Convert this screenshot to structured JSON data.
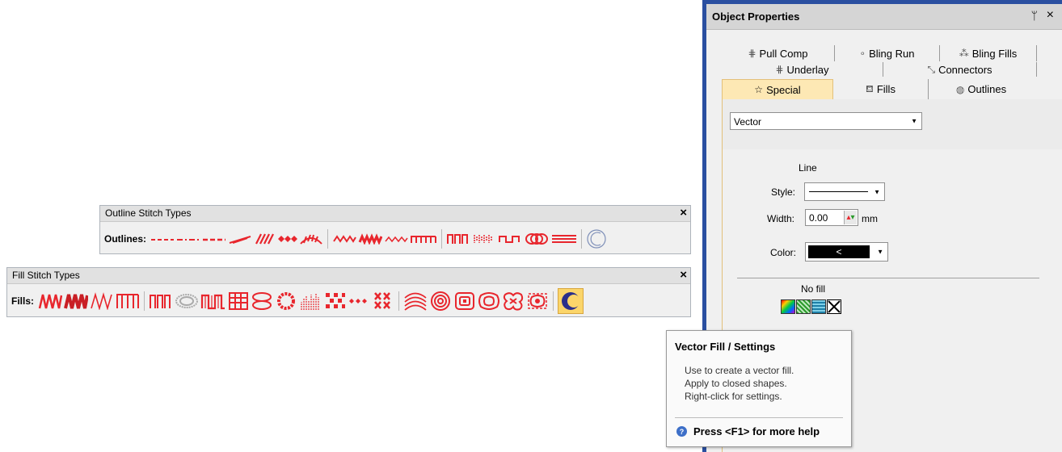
{
  "outline_toolbar": {
    "title": "Outline Stitch Types",
    "close": "×",
    "row_label": "Outlines:",
    "icons": [
      "dash-outline-icon",
      "dash-dot-outline-icon",
      "triple-dash-outline-icon",
      "zigzag-outline-icon",
      "satin-outline-icon",
      "motif-outline-icon",
      "feather-outline-icon",
      "blackwork-outline-icon",
      "e-stitch-outline-icon",
      "frill-outline-icon",
      "square-outline-icon",
      "tatami-outline-icon",
      "fancy-outline-icon",
      "backstitch-outline-icon",
      "ring-outline-icon",
      "striped-outline-icon",
      "crescent-outline-icon"
    ]
  },
  "fill_toolbar": {
    "title": "Fill Stitch Types",
    "close": "×",
    "row_label": "Fills:",
    "icons": [
      "zigzag-fill-icon",
      "satin-fill-icon",
      "diagonal-fill-icon",
      "square-fill-icon",
      "tatami-fill-icon",
      "ring-fill-icon",
      "step-fill-icon",
      "cross-fill-icon",
      "link-fill-icon",
      "flower-fill-icon",
      "gradient-fill-icon",
      "diamond-fill-icon",
      "sparkle-fill-icon",
      "x-fill-icon",
      "wave-fill-icon",
      "spiral-fill-icon",
      "square-spiral-fill-icon",
      "fancy-fill-icon",
      "motif-fill-icon",
      "lace-fill-icon",
      "vector-fill-icon"
    ],
    "selected_icon": "vector-fill-icon"
  },
  "object_properties": {
    "title": "Object Properties",
    "pin": "ᛘ",
    "close": "×",
    "tabs_row1": [
      {
        "label": "Pull Comp",
        "icon": "pull-comp-icon"
      },
      {
        "label": "Bling Run",
        "icon": "bling-run-icon"
      },
      {
        "label": "Bling Fills",
        "icon": "bling-fills-icon"
      }
    ],
    "tabs_row2": [
      {
        "label": "Underlay",
        "icon": "underlay-icon"
      },
      {
        "label": "Connectors",
        "icon": "connectors-icon"
      }
    ],
    "tabs_row3": [
      {
        "label": "Special",
        "icon": "star-icon",
        "active": true
      },
      {
        "label": "Fills",
        "icon": "paint-bucket-icon"
      },
      {
        "label": "Outlines",
        "icon": "outline-icon"
      }
    ],
    "mode_dropdown": "Vector",
    "line_heading": "Line",
    "style_label": "Style:",
    "width_label": "Width:",
    "width_value": "0.00",
    "width_unit": "mm",
    "color_label": "Color:",
    "color_arrow": "<",
    "color_value": "#000000",
    "fill_heading": "No fill"
  },
  "tooltip": {
    "title": "Vector Fill / Settings",
    "lines": [
      "Use to create a vector fill.",
      "Apply to closed shapes.",
      "Right-click for settings."
    ],
    "help": "Press <F1> for more help"
  },
  "colors": {
    "stitch_red": "#e8262d",
    "panel_border": "#2a4fa0",
    "active_tab": "#fde8b4",
    "selected_tool": "#fbd56a"
  }
}
